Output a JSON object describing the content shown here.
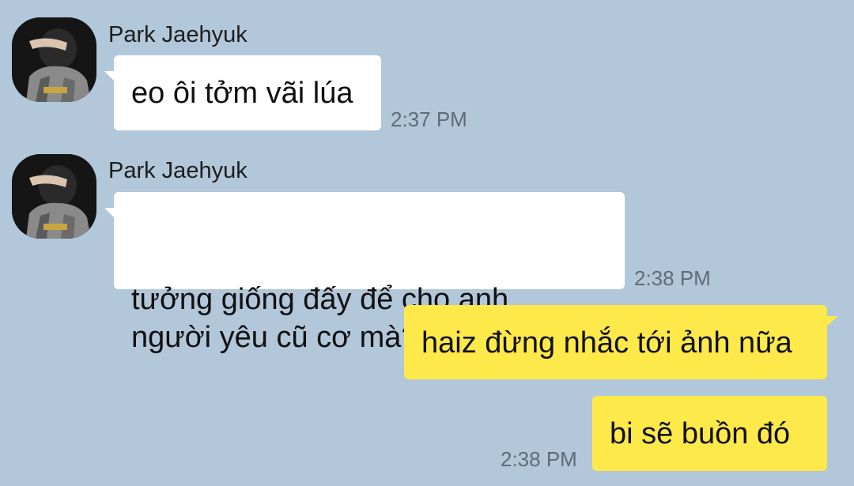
{
  "colors": {
    "background": "#b2c7d9",
    "incoming_bubble": "#ffffff",
    "outgoing_bubble": "#fde94a",
    "timestamp": "#5f6c78"
  },
  "messages": [
    {
      "direction": "incoming",
      "sender": "Park Jaehyuk",
      "avatar_icon": "profile-photo",
      "text": "eo ôi tởm vãi lúa",
      "time": "2:37 PM"
    },
    {
      "direction": "incoming",
      "sender": "Park Jaehyuk",
      "avatar_icon": "profile-photo",
      "text": "tưởng giống đấy để cho anh\nngười yêu cũ cơ mà?",
      "time": "2:38 PM"
    },
    {
      "direction": "outgoing",
      "text": "haiz đừng nhắc tới ảnh nữa",
      "time": ""
    },
    {
      "direction": "outgoing",
      "text": "bi sẽ buồn đó",
      "time": "2:38 PM"
    }
  ]
}
